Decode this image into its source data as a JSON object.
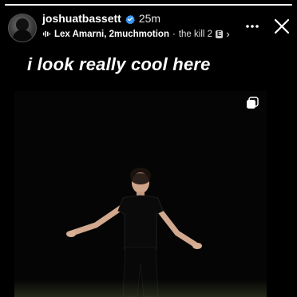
{
  "story": {
    "progress": 1.0
  },
  "header": {
    "username": "joshuatbassett",
    "time": "25m",
    "music": {
      "artists": "Lex Amarni, 2muchmotion",
      "separator": "·",
      "song": "the kill 2",
      "explicit_label": "E"
    }
  },
  "caption": "i look really cool here",
  "icons": {
    "verified": "verified-badge-icon",
    "music": "music-note-icon",
    "more": "more-horizontal-icon",
    "close": "close-icon",
    "multi_photo": "multi-photo-icon"
  },
  "colors": {
    "background": "#000000",
    "text": "#ffffff"
  }
}
